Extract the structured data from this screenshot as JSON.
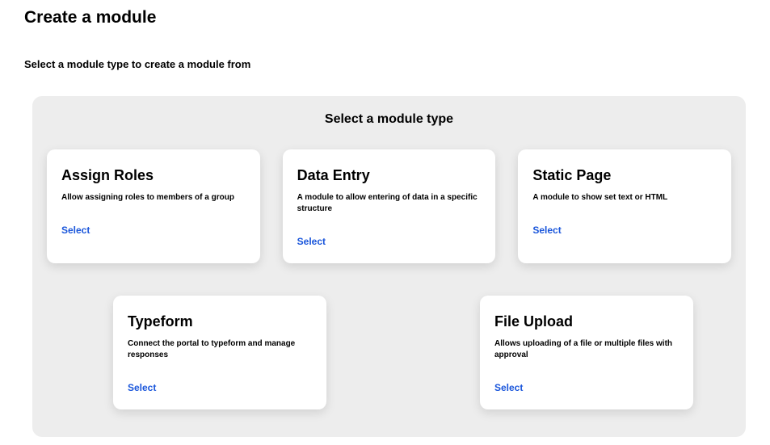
{
  "header": {
    "title": "Create a module",
    "subtitle": "Select a module type to create a module from"
  },
  "panel": {
    "title": "Select a module type"
  },
  "cards": [
    {
      "title": "Assign Roles",
      "description": "Allow assigning roles to members of a group",
      "action": "Select"
    },
    {
      "title": "Data Entry",
      "description": "A module to allow entering of data in a specific structure",
      "action": "Select"
    },
    {
      "title": "Static Page",
      "description": "A module to show set text or HTML",
      "action": "Select"
    },
    {
      "title": "Typeform",
      "description": "Connect the portal to typeform and manage responses",
      "action": "Select"
    },
    {
      "title": "File Upload",
      "description": "Allows uploading of a file or multiple files with approval",
      "action": "Select"
    }
  ]
}
